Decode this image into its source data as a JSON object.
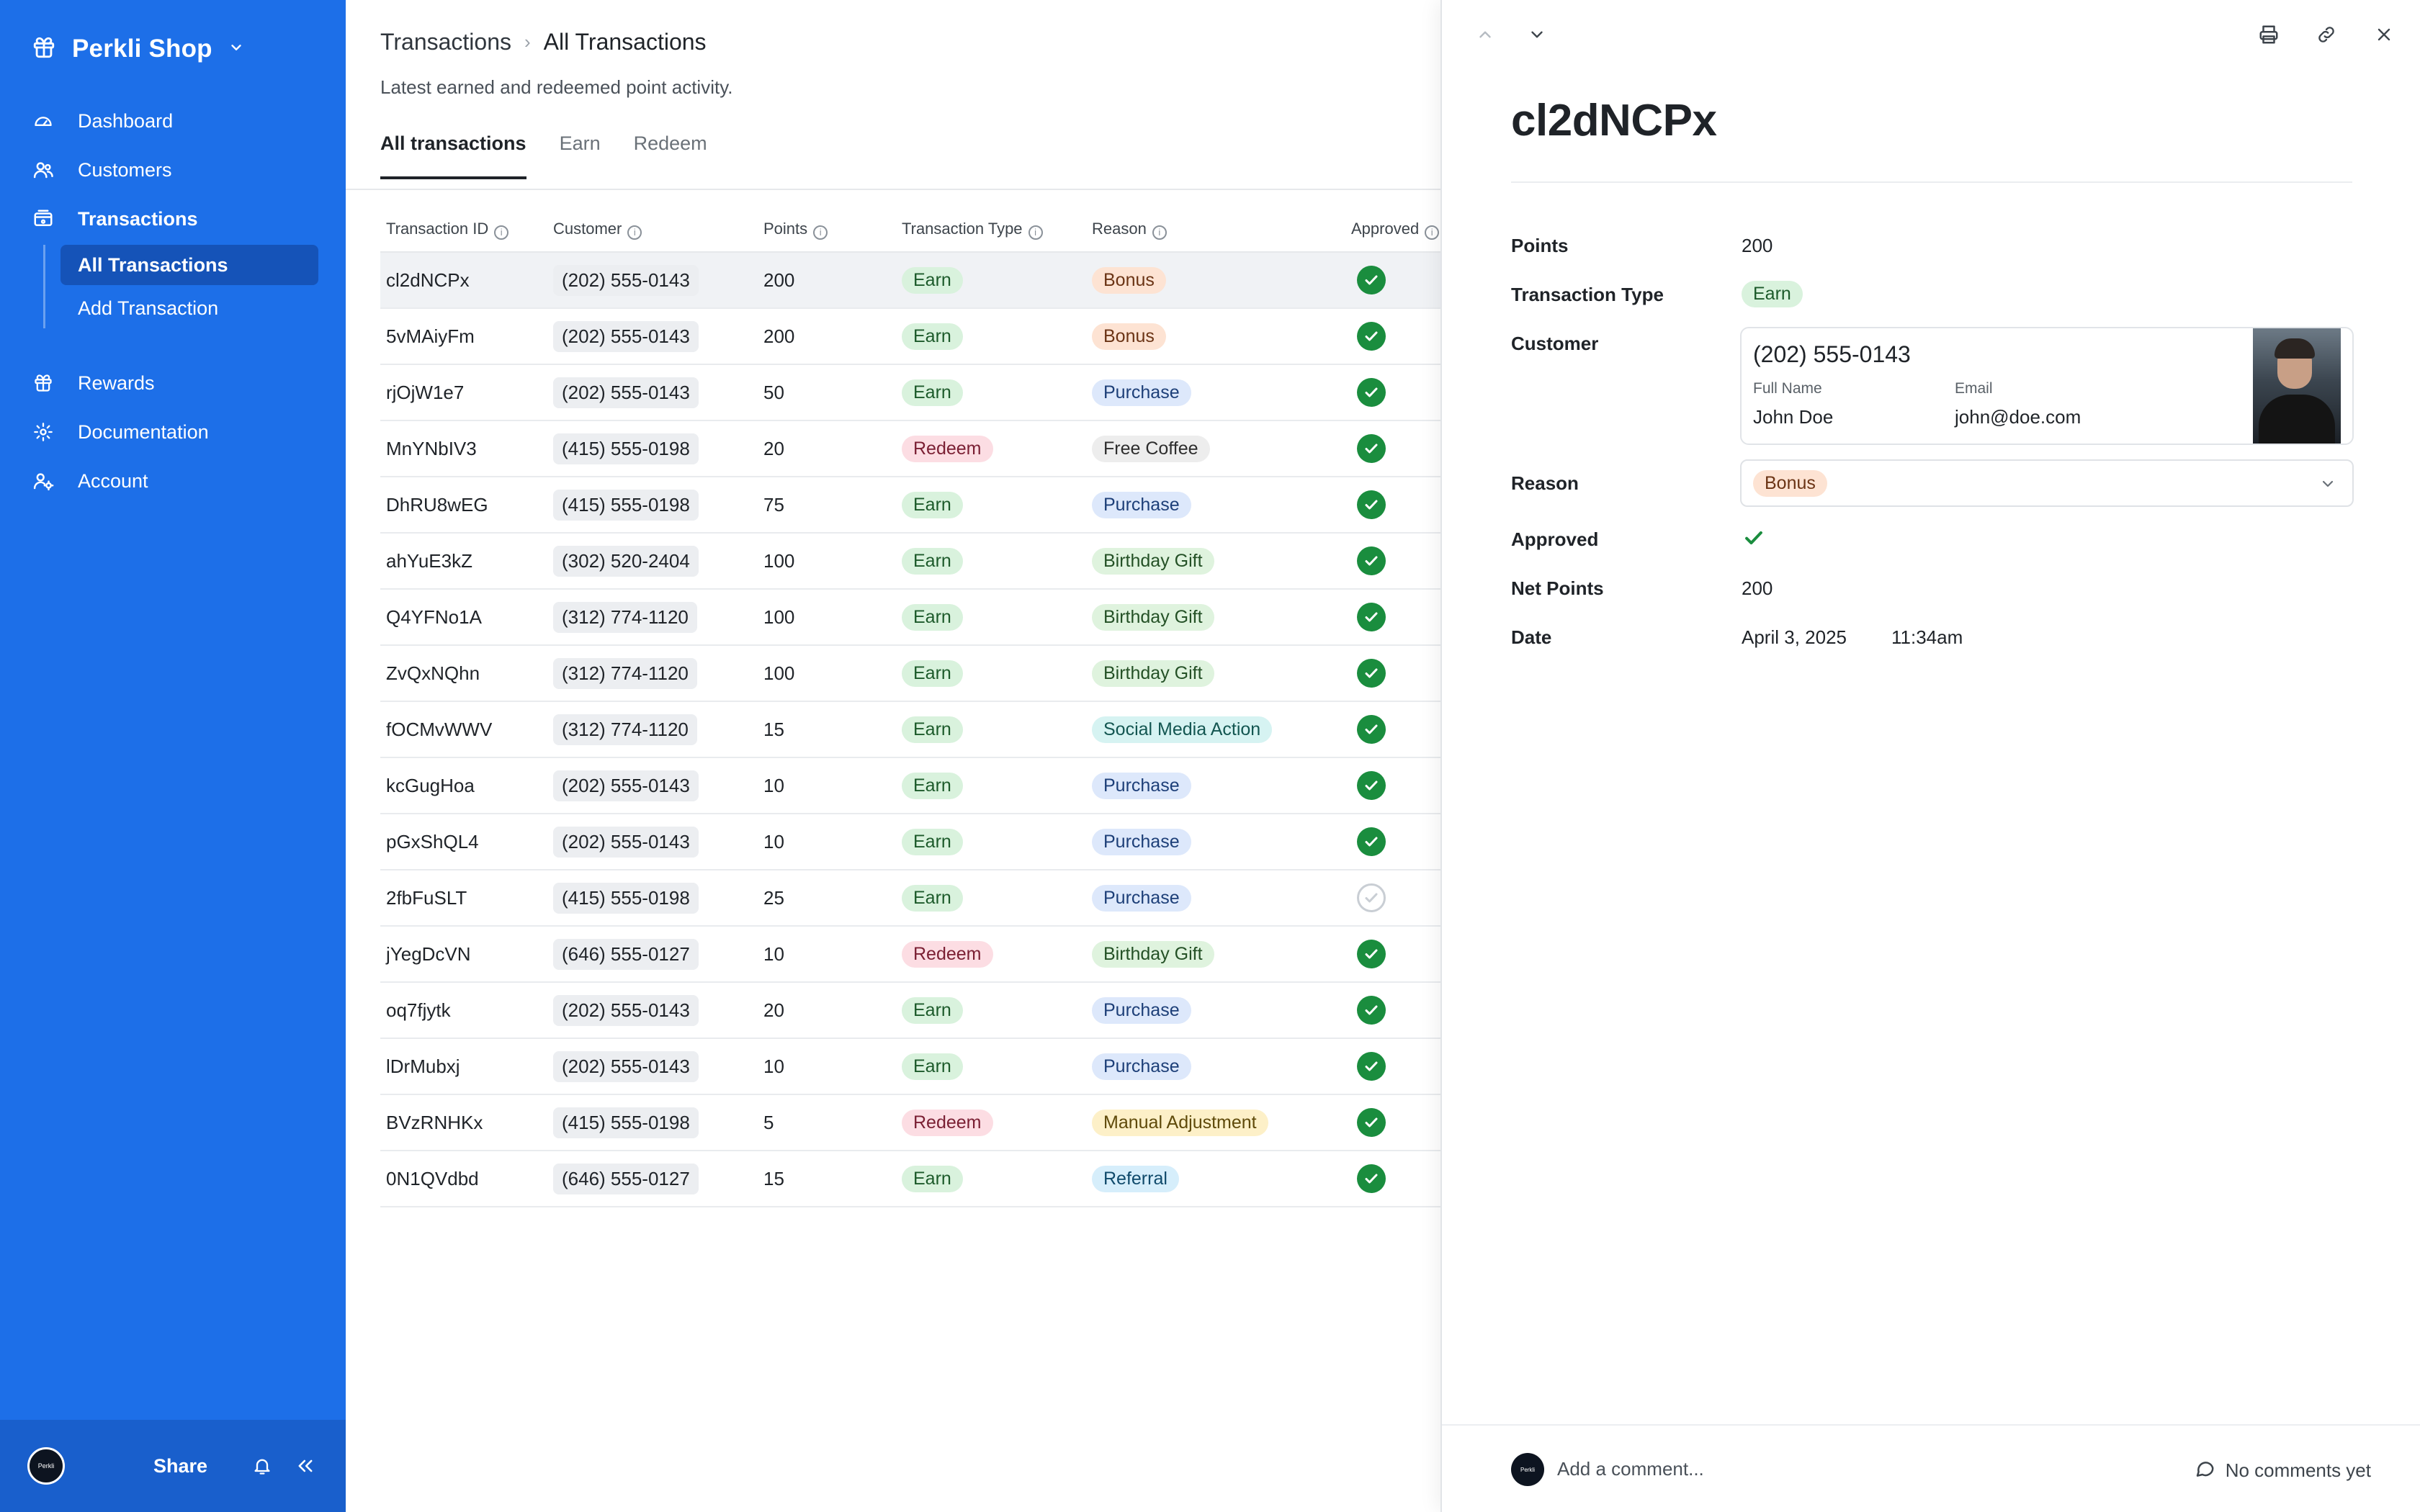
{
  "sidebar": {
    "brand": "Perkli Shop",
    "items": [
      {
        "label": "Dashboard",
        "icon": "dashboard-icon"
      },
      {
        "label": "Customers",
        "icon": "users-icon"
      },
      {
        "label": "Transactions",
        "icon": "transactions-icon"
      },
      {
        "label": "Rewards",
        "icon": "gift-icon"
      },
      {
        "label": "Documentation",
        "icon": "gear-icon"
      },
      {
        "label": "Account",
        "icon": "account-icon"
      }
    ],
    "subitems": [
      "All Transactions",
      "Add Transaction"
    ],
    "footer": {
      "avatar_text": "Perkli",
      "share": "Share"
    }
  },
  "main": {
    "breadcrumb": [
      "Transactions",
      "All Transactions"
    ],
    "subtitle": "Latest earned and redeemed point activity.",
    "tabs": [
      "All transactions",
      "Earn",
      "Redeem"
    ],
    "columns": [
      "Transaction ID",
      "Customer",
      "Points",
      "Transaction Type",
      "Reason",
      "Approved"
    ],
    "rows": [
      {
        "id": "cl2dNCPx",
        "customer": "(202) 555-0143",
        "points": "200",
        "type": "Earn",
        "reason": "Bonus",
        "approved": true
      },
      {
        "id": "5vMAiyFm",
        "customer": "(202) 555-0143",
        "points": "200",
        "type": "Earn",
        "reason": "Bonus",
        "approved": true
      },
      {
        "id": "rjOjW1e7",
        "customer": "(202) 555-0143",
        "points": "50",
        "type": "Earn",
        "reason": "Purchase",
        "approved": true
      },
      {
        "id": "MnYNbIV3",
        "customer": "(415) 555-0198",
        "points": "20",
        "type": "Redeem",
        "reason": "Free Coffee",
        "approved": true
      },
      {
        "id": "DhRU8wEG",
        "customer": "(415) 555-0198",
        "points": "75",
        "type": "Earn",
        "reason": "Purchase",
        "approved": true
      },
      {
        "id": "ahYuE3kZ",
        "customer": "(302) 520-2404",
        "points": "100",
        "type": "Earn",
        "reason": "Birthday Gift",
        "approved": true
      },
      {
        "id": "Q4YFNo1A",
        "customer": "(312) 774-1120",
        "points": "100",
        "type": "Earn",
        "reason": "Birthday Gift",
        "approved": true
      },
      {
        "id": "ZvQxNQhn",
        "customer": "(312) 774-1120",
        "points": "100",
        "type": "Earn",
        "reason": "Birthday Gift",
        "approved": true
      },
      {
        "id": "fOCMvWWV",
        "customer": "(312) 774-1120",
        "points": "15",
        "type": "Earn",
        "reason": "Social Media Action",
        "approved": true
      },
      {
        "id": "kcGugHoa",
        "customer": "(202) 555-0143",
        "points": "10",
        "type": "Earn",
        "reason": "Purchase",
        "approved": true
      },
      {
        "id": "pGxShQL4",
        "customer": "(202) 555-0143",
        "points": "10",
        "type": "Earn",
        "reason": "Purchase",
        "approved": true
      },
      {
        "id": "2fbFuSLT",
        "customer": "(415) 555-0198",
        "points": "25",
        "type": "Earn",
        "reason": "Purchase",
        "approved": false
      },
      {
        "id": "jYegDcVN",
        "customer": "(646) 555-0127",
        "points": "10",
        "type": "Redeem",
        "reason": "Birthday Gift",
        "approved": true
      },
      {
        "id": "oq7fjytk",
        "customer": "(202) 555-0143",
        "points": "20",
        "type": "Earn",
        "reason": "Purchase",
        "approved": true
      },
      {
        "id": "lDrMubxj",
        "customer": "(202) 555-0143",
        "points": "10",
        "type": "Earn",
        "reason": "Purchase",
        "approved": true
      },
      {
        "id": "BVzRNHKx",
        "customer": "(415) 555-0198",
        "points": "5",
        "type": "Redeem",
        "reason": "Manual Adjustment",
        "approved": true
      },
      {
        "id": "0N1QVdbd",
        "customer": "(646) 555-0127",
        "points": "15",
        "type": "Earn",
        "reason": "Referral",
        "approved": true
      }
    ]
  },
  "detail": {
    "title": "cl2dNCPx",
    "labels": {
      "points": "Points",
      "type": "Transaction Type",
      "customer": "Customer",
      "reason": "Reason",
      "approved": "Approved",
      "net_points": "Net Points",
      "date": "Date"
    },
    "points": "200",
    "type": "Earn",
    "customer": {
      "phone": "(202) 555-0143",
      "full_name_label": "Full Name",
      "full_name": "John Doe",
      "email_label": "Email",
      "email": "john@doe.com"
    },
    "reason": "Bonus",
    "net_points": "200",
    "date": "April 3, 2025",
    "time": "11:34am",
    "comment_placeholder": "Add a comment...",
    "no_comments": "No comments yet",
    "avatar_text": "Perkli"
  },
  "colors": {
    "sidebar": "#1d6fe8",
    "sidebar_active": "#1553b8",
    "approved": "#1a8d3e",
    "earn_bg": "#d9f2dd",
    "earn_fg": "#1c5a2a",
    "redeem_bg": "#fcdde3",
    "redeem_fg": "#7a1f33",
    "bonus_bg": "#fde3d3",
    "bonus_fg": "#6b3415",
    "purchase_bg": "#dde8fb",
    "purchase_fg": "#1d3f78",
    "birthday_bg": "#dff3de",
    "birthday_fg": "#245126",
    "coffee_bg": "#ededed",
    "coffee_fg": "#2d2d2d",
    "social_bg": "#d6f3f2",
    "social_fg": "#135651",
    "manual_bg": "#fdf0c8",
    "manual_fg": "#5f4a0a",
    "referral_bg": "#d6eefb",
    "referral_fg": "#0f4a6b"
  }
}
